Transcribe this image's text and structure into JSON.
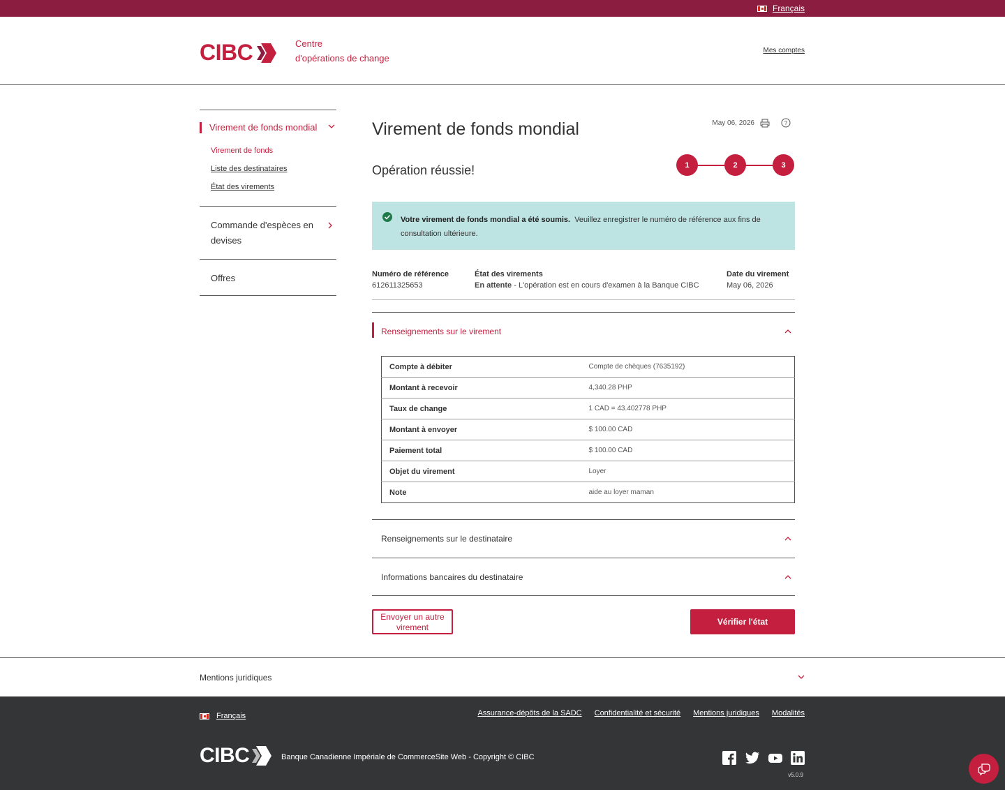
{
  "topbar": {
    "language": "Français"
  },
  "header": {
    "logo_text": "CIBC",
    "subtitle_line1": "Centre",
    "subtitle_line2": "d'opérations de change",
    "my_accounts": "Mes comptes"
  },
  "sidebar": {
    "active_section": "Virement de fonds mondial",
    "sub_items": [
      "Virement de fonds",
      "Liste des destinataires",
      "État des virements"
    ],
    "cash_order": "Commande d'espèces en devises",
    "offers": "Offres"
  },
  "main": {
    "title": "Virement de fonds mondial",
    "date": "May 06, 2026",
    "success_title": "Opération réussie!",
    "steps": [
      "1",
      "2",
      "3"
    ],
    "alert": {
      "bold": "Votre virement de fonds mondial a été soumis.",
      "text": "Veuillez enregistrer le numéro de référence aux fins de consultation ultérieure."
    },
    "reference": {
      "ref_label": "Numéro de référence",
      "ref_value": "612611325653",
      "status_label": "État des virements",
      "status_bold": "En attente",
      "status_text": " - L'opération est en cours d'examen à la Banque CIBC",
      "date_label": "Date du virement",
      "date_value": "May 06, 2026"
    },
    "transfer_section": "Renseignements sur le virement",
    "details": [
      {
        "label": "Compte à débiter",
        "value": "Compte de chèques (7635192)"
      },
      {
        "label": "Montant à recevoir",
        "value": "4,340.28 PHP"
      },
      {
        "label": "Taux de change",
        "value": "1 CAD = 43.402778 PHP"
      },
      {
        "label": "Montant à envoyer",
        "value": "$ 100.00 CAD"
      },
      {
        "label": "Paiement total",
        "value": "$ 100.00 CAD"
      },
      {
        "label": "Objet du virement",
        "value": "Loyer"
      },
      {
        "label": "Note",
        "value": "aide au loyer maman"
      }
    ],
    "recipient_section": "Renseignements sur le destinataire",
    "bank_section": "Informations bancaires du destinataire",
    "btn_send_another": "Envoyer un autre virement",
    "btn_check_status": "Vérifier l'état"
  },
  "legal": {
    "title": "Mentions juridiques"
  },
  "footer": {
    "language": "Français",
    "links": [
      "Assurance-dépôts de la SADC",
      "Confidentialité et sécurité",
      "Mentions juridiques",
      "Modalités"
    ],
    "logo_text": "CIBC",
    "copyright": "Banque Canadienne Impériale de CommerceSite Web - Copyright © CIBC",
    "version": "v5.0.9"
  },
  "colors": {
    "brand": "#c41f3e",
    "topbar": "#8b1d41",
    "alert_bg": "#bde3e3",
    "footer_bg": "#333536"
  }
}
